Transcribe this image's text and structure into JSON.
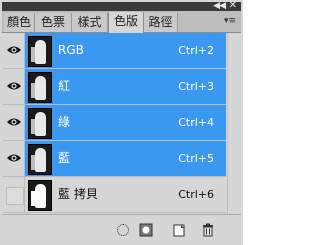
{
  "panel": {
    "tabs": [
      {
        "label": "顏色"
      },
      {
        "label": "色票"
      },
      {
        "label": "樣式"
      },
      {
        "label": "色版"
      },
      {
        "label": "路徑"
      }
    ],
    "active_tab": "色版",
    "collapse_glyph": "◀◀",
    "close_glyph": "✕",
    "menu_glyph": "▾≡"
  },
  "channels": [
    {
      "name": "RGB",
      "shortcut": "Ctrl+2",
      "visible": true,
      "selected": true
    },
    {
      "name": "紅",
      "shortcut": "Ctrl+3",
      "visible": true,
      "selected": true
    },
    {
      "name": "綠",
      "shortcut": "Ctrl+4",
      "visible": true,
      "selected": true
    },
    {
      "name": "藍",
      "shortcut": "Ctrl+5",
      "visible": true,
      "selected": true
    },
    {
      "name": "藍 拷貝",
      "shortcut": "Ctrl+6",
      "visible": false,
      "selected": false
    }
  ],
  "bottom_icons": [
    "load-selection-icon",
    "save-selection-mask-icon",
    "new-channel-icon",
    "delete-channel-icon"
  ],
  "colors": {
    "selected": "#3b98f0",
    "panel_bg": "#d6d6d6",
    "titlebar": "#3a3a3a"
  }
}
